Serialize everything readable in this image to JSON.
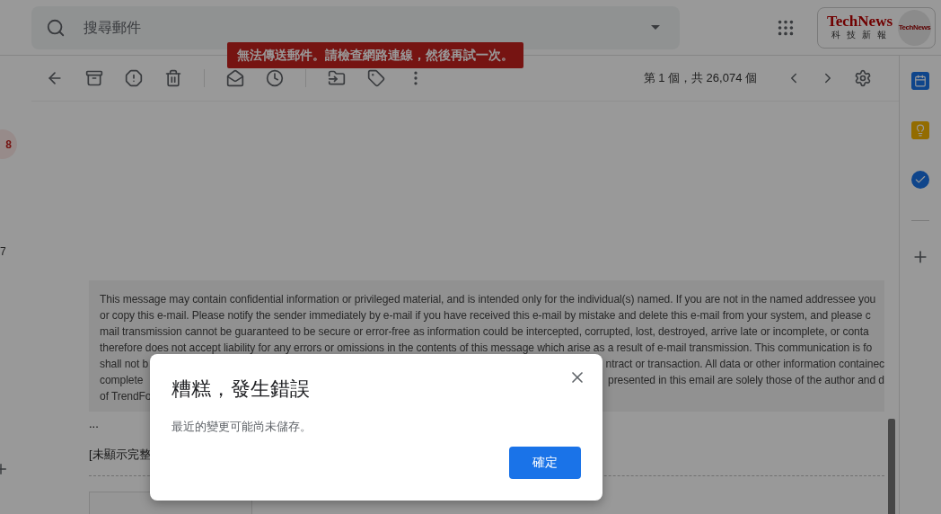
{
  "search": {
    "placeholder": "搜尋郵件"
  },
  "account": {
    "logo_title": "TechNews",
    "logo_subtitle": "科 技 新 報",
    "avatar_text": "TechNews"
  },
  "snackbar": "無法傳送郵件。請檢查網路連線，然後再試一次。",
  "left_rail": {
    "badge": "8",
    "count": "7"
  },
  "pagination": "第 1 個，共 26,074 個",
  "message": {
    "disclaimer_lines": [
      {
        "segments": [
          "This message may contain confidential information or privileged material, and is intended only for the individual(s) named. If you are not in the named addressee you"
        ]
      },
      {
        "segments": [
          "or copy this e-mail. Please notify the sender immediately by e-mail if you have received this e-mail by mistake and delete this e-mail from your system, and please c"
        ]
      },
      {
        "segments": [
          "mail transmission cannot be guaranteed to be secure or error-free as information could be intercepted, corrupted, lost, destroyed, arrive late or incomplete, or conta"
        ]
      },
      {
        "segments": [
          "therefore does not accept liability for any errors or omissions in the contents of this message which arise as a result of e-mail transmission. This communication is fo"
        ]
      },
      {
        "segments": [
          "shall not b",
          "ntract or transaction. All data or other information containec"
        ]
      },
      {
        "segments": [
          "complete",
          "presented in this email are solely those of the author and d"
        ]
      },
      {
        "segments": [
          "of TrendFo"
        ]
      }
    ],
    "ellipsis": "...",
    "trimmed": "[未顯示完整"
  },
  "dialog": {
    "title": "糟糕，發生錯誤",
    "body": "最近的變更可能尚未儲存。",
    "button": "確定"
  }
}
